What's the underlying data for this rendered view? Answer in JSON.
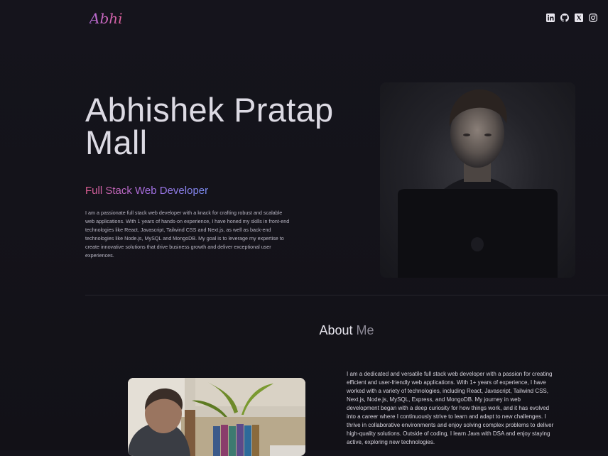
{
  "nav": {
    "logo_text": "Abhi",
    "socials": [
      {
        "icon": "linkedin-icon",
        "label": "LinkedIn"
      },
      {
        "icon": "github-icon",
        "label": "GitHub"
      },
      {
        "icon": "x-icon",
        "label": "X"
      },
      {
        "icon": "instagram-icon",
        "label": "Instagram"
      }
    ]
  },
  "hero": {
    "name_line1": "Abhishek Pratap",
    "name_line2": "Mall",
    "role": "Full Stack Web Developer",
    "bio": "I am a passionate full stack web developer with a knack for crafting robust and scalable web applications. With 1 years of hands-on experience, I have honed my skills in front-end technologies like React, Javascript, Tailwind CSS and Next.js, as well as back-end technologies like Node.js, MySQL and MongoDB. My goal is to leverage my expertise to create innovative solutions that drive business growth and deliver exceptional user experiences."
  },
  "about": {
    "title_main": "About",
    "title_muted": "Me",
    "text": "I am a dedicated and versatile full stack web developer with a passion for creating efficient and user-friendly web applications. With 1+ years of experience, I have worked with a variety of technologies, including React, Javascript, Tailwind CSS, Next.js, Node.js, MySQL, Express, and MongoDB. My journey in web development began with a deep curiosity for how things work, and it has evolved into a career where I continuously strive to learn and adapt to new challenges. I thrive in collaborative environments and enjoy solving complex problems to deliver high-quality solutions. Outside of coding, I learn Java with DSA and enjoy staying active, exploring new technologies."
  },
  "colors": {
    "background": "#15141c",
    "accent_pink": "#e25f93",
    "accent_purple": "#a66ee3",
    "accent_blue": "#7c8ef5"
  }
}
